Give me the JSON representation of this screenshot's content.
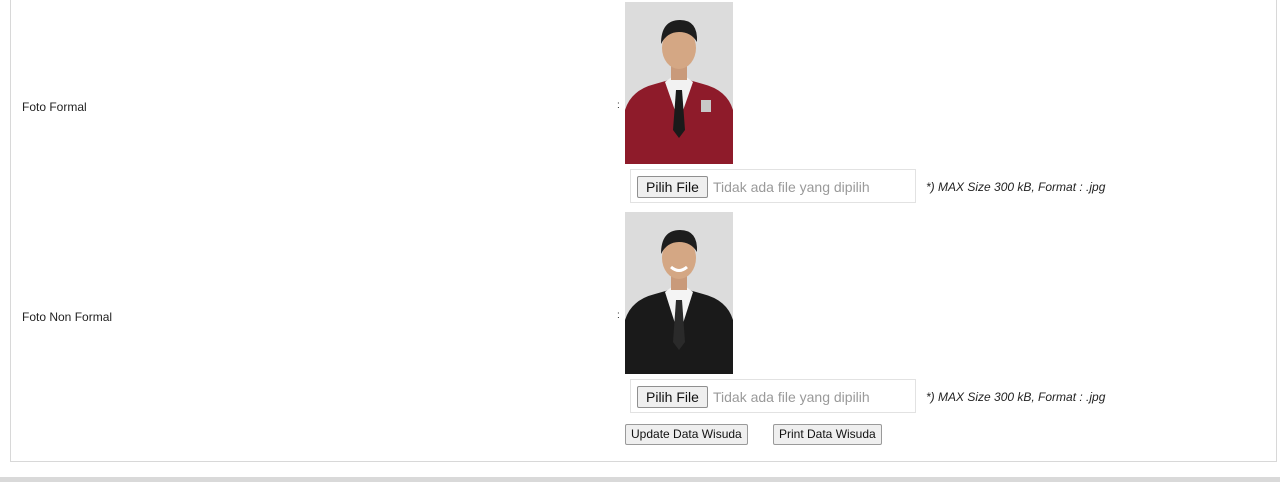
{
  "rows": [
    {
      "label": "Foto Formal",
      "colon": ":",
      "photo_icon": "formal-portrait-photo",
      "file_button": "Pilih File",
      "file_status": "Tidak ada file yang dipilih",
      "note": "*) MAX Size 300 kB, Format : .jpg"
    },
    {
      "label": "Foto Non Formal",
      "colon": ":",
      "photo_icon": "non-formal-portrait-photo",
      "file_button": "Pilih File",
      "file_status": "Tidak ada file yang dipilih",
      "note": "*) MAX Size 300 kB, Format : .jpg"
    }
  ],
  "actions": {
    "update_label": "Update Data Wisuda",
    "print_label": "Print Data Wisuda"
  },
  "colors": {
    "formal_jacket": "#8e1b2a",
    "nonformal_jacket": "#1a1a1a",
    "photo_background": "#dcdcdc"
  }
}
